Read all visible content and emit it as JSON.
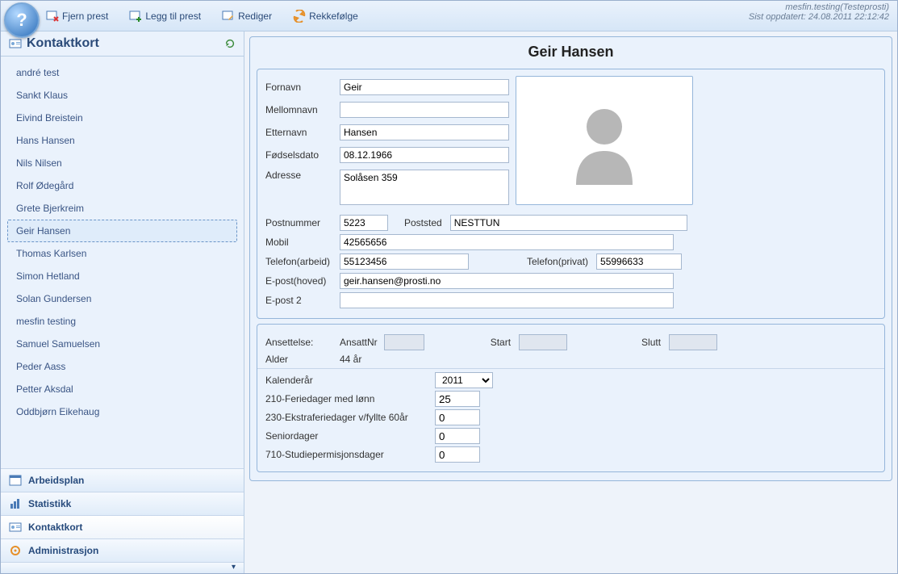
{
  "header": {
    "user": "mesfin.testing(Testeprosti)",
    "updated": "Sist oppdatert: 24.08.2011 22:12:42"
  },
  "toolbar": {
    "remove": "Fjern prest",
    "add": "Legg til prest",
    "edit": "Rediger",
    "order": "Rekkefølge"
  },
  "sidebar": {
    "title": "Kontaktkort",
    "items": [
      {
        "label": "andré test"
      },
      {
        "label": "Sankt Klaus"
      },
      {
        "label": "Eivind Breistein"
      },
      {
        "label": "Hans Hansen"
      },
      {
        "label": "Nils Nilsen"
      },
      {
        "label": "Rolf Ødegård"
      },
      {
        "label": "Grete Bjerkreim"
      },
      {
        "label": "Geir Hansen"
      },
      {
        "label": "Thomas Karlsen"
      },
      {
        "label": "Simon Hetland"
      },
      {
        "label": "Solan Gundersen"
      },
      {
        "label": "mesfin testing"
      },
      {
        "label": "Samuel Samuelsen"
      },
      {
        "label": "Peder Aass"
      },
      {
        "label": "Petter Aksdal"
      },
      {
        "label": "Oddbjørn Eikehaug"
      }
    ],
    "selected_index": 7
  },
  "nav": {
    "work_plan": "Arbeidsplan",
    "stats": "Statistikk",
    "contactcard": "Kontaktkort",
    "admin": "Administrasjon"
  },
  "contact": {
    "title": "Geir  Hansen",
    "labels": {
      "fornavn": "Fornavn",
      "mellomnavn": "Mellomnavn",
      "etternavn": "Etternavn",
      "fodselsdato": "Fødselsdato",
      "adresse": "Adresse",
      "postnummer": "Postnummer",
      "poststed": "Poststed",
      "mobil": "Mobil",
      "telefon_arbeid": "Telefon(arbeid)",
      "telefon_privat": "Telefon(privat)",
      "epost_hoved": "E-post(hoved)",
      "epost2": "E-post 2"
    },
    "values": {
      "fornavn": "Geir",
      "mellomnavn": "",
      "etternavn": "Hansen",
      "fodselsdato": "08.12.1966",
      "adresse": "Solåsen 359",
      "postnummer": "5223",
      "poststed": "NESTTUN",
      "mobil": "42565656",
      "telefon_arbeid": "55123456",
      "telefon_privat": "55996633",
      "epost_hoved": "geir.hansen@prosti.no",
      "epost2": ""
    }
  },
  "employment": {
    "labels": {
      "ansettelse": "Ansettelse:",
      "ansattnr": "AnsattNr",
      "start": "Start",
      "slutt": "Slutt",
      "alder": "Alder",
      "kalenderar": "Kalenderår",
      "feriedager": "210-Feriedager med lønn",
      "ekstraferie": "230-Ekstraferiedager v/fyllte 60år",
      "seniordager": "Seniordager",
      "studieperm": "710-Studiepermisjonsdager"
    },
    "values": {
      "ansattnr": "",
      "start": "",
      "slutt": "",
      "alder": "44 år",
      "kalenderar": "2011",
      "feriedager": "25",
      "ekstraferie": "0",
      "seniordager": "0",
      "studieperm": "0"
    }
  }
}
